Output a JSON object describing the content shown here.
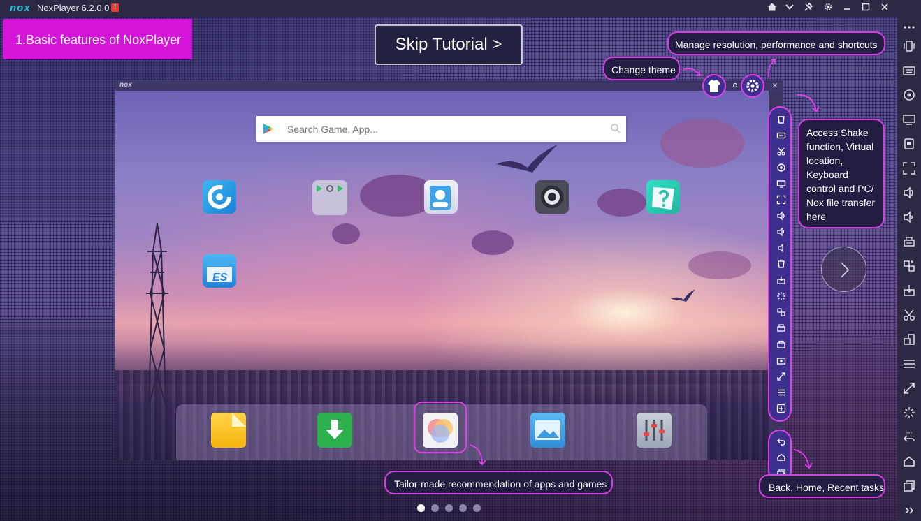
{
  "titlebar": {
    "logo": "nox",
    "app_title": "NoxPlayer 6.2.0.0",
    "alert_badge": "!"
  },
  "tutorial": {
    "step_label": "1.Basic features of NoxPlayer",
    "skip_label": "Skip Tutorial >",
    "callouts": {
      "manage": "Manage resolution, performance and shortcuts",
      "theme": "Change theme",
      "access": "Access Shake function, Virtual location, Keyboard control and PC/ Nox file transfer here",
      "recommend": "Tailor-made recommendation of apps and games",
      "nav": "Back, Home, Recent tasks"
    },
    "pages": [
      true,
      false,
      false,
      false,
      false
    ]
  },
  "emulator": {
    "logo": "nox",
    "search_placeholder": "Search Game, App..."
  },
  "colors": {
    "accent": "#d414d9",
    "ring": "#e040e8",
    "capsule": "#3c2f8e",
    "titlebar": "#2b2943"
  }
}
